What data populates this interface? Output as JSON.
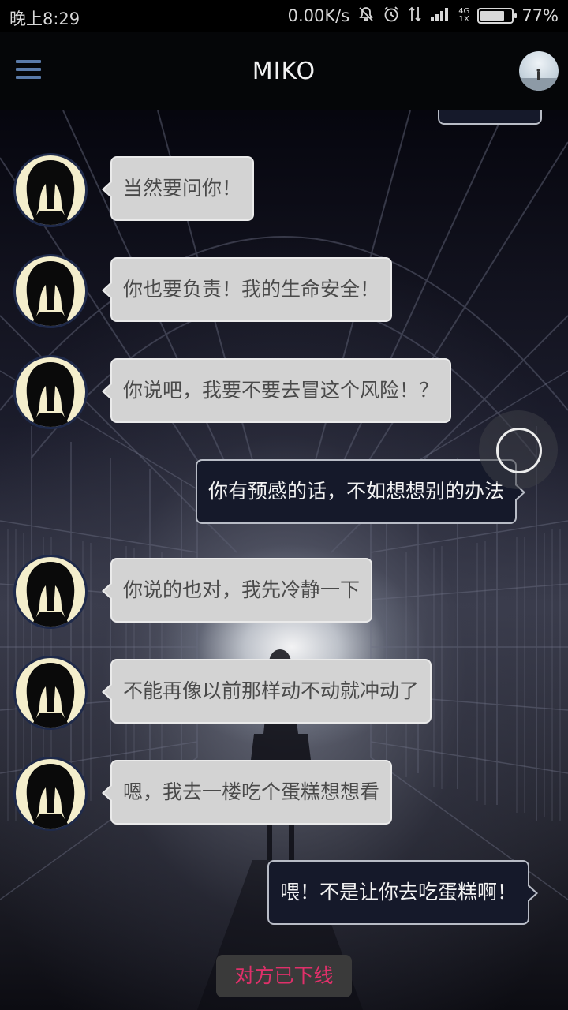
{
  "status_bar": {
    "time": "晚上8:29",
    "net_speed": "0.00K/s",
    "network_type_top": "4G",
    "network_type_bottom": "1X",
    "battery_percent": "77%",
    "battery_level": 0.77,
    "icons": [
      "mute-icon",
      "alarm-icon",
      "data-arrows-icon",
      "signal-icon",
      "battery-icon"
    ]
  },
  "header": {
    "title": "MIKO",
    "menu_icon": "hamburger-menu-icon",
    "avatar": "profile-avatar"
  },
  "messages": [
    {
      "side": "in",
      "text": "当然要问你！"
    },
    {
      "side": "in",
      "text": "你也要负责！我的生命安全！"
    },
    {
      "side": "in",
      "text": "你说吧，我要不要去冒这个风险！？"
    },
    {
      "side": "out",
      "text": "你有预感的话，不如想想别的办法"
    },
    {
      "side": "in",
      "text": "你说的也对，我先冷静一下"
    },
    {
      "side": "in",
      "text": "不能再像以前那样动不动就冲动了"
    },
    {
      "side": "in",
      "text": "嗯，我去一楼吃个蛋糕想想看"
    },
    {
      "side": "out",
      "text": "喂！不是让你去吃蛋糕啊！"
    }
  ],
  "status_notice": "对方已下线",
  "colors": {
    "incoming_bubble": "#d3d3d3",
    "outgoing_bubble": "#15192a",
    "offline_text": "#e0306a",
    "menu_icon": "#5a7aa8"
  }
}
